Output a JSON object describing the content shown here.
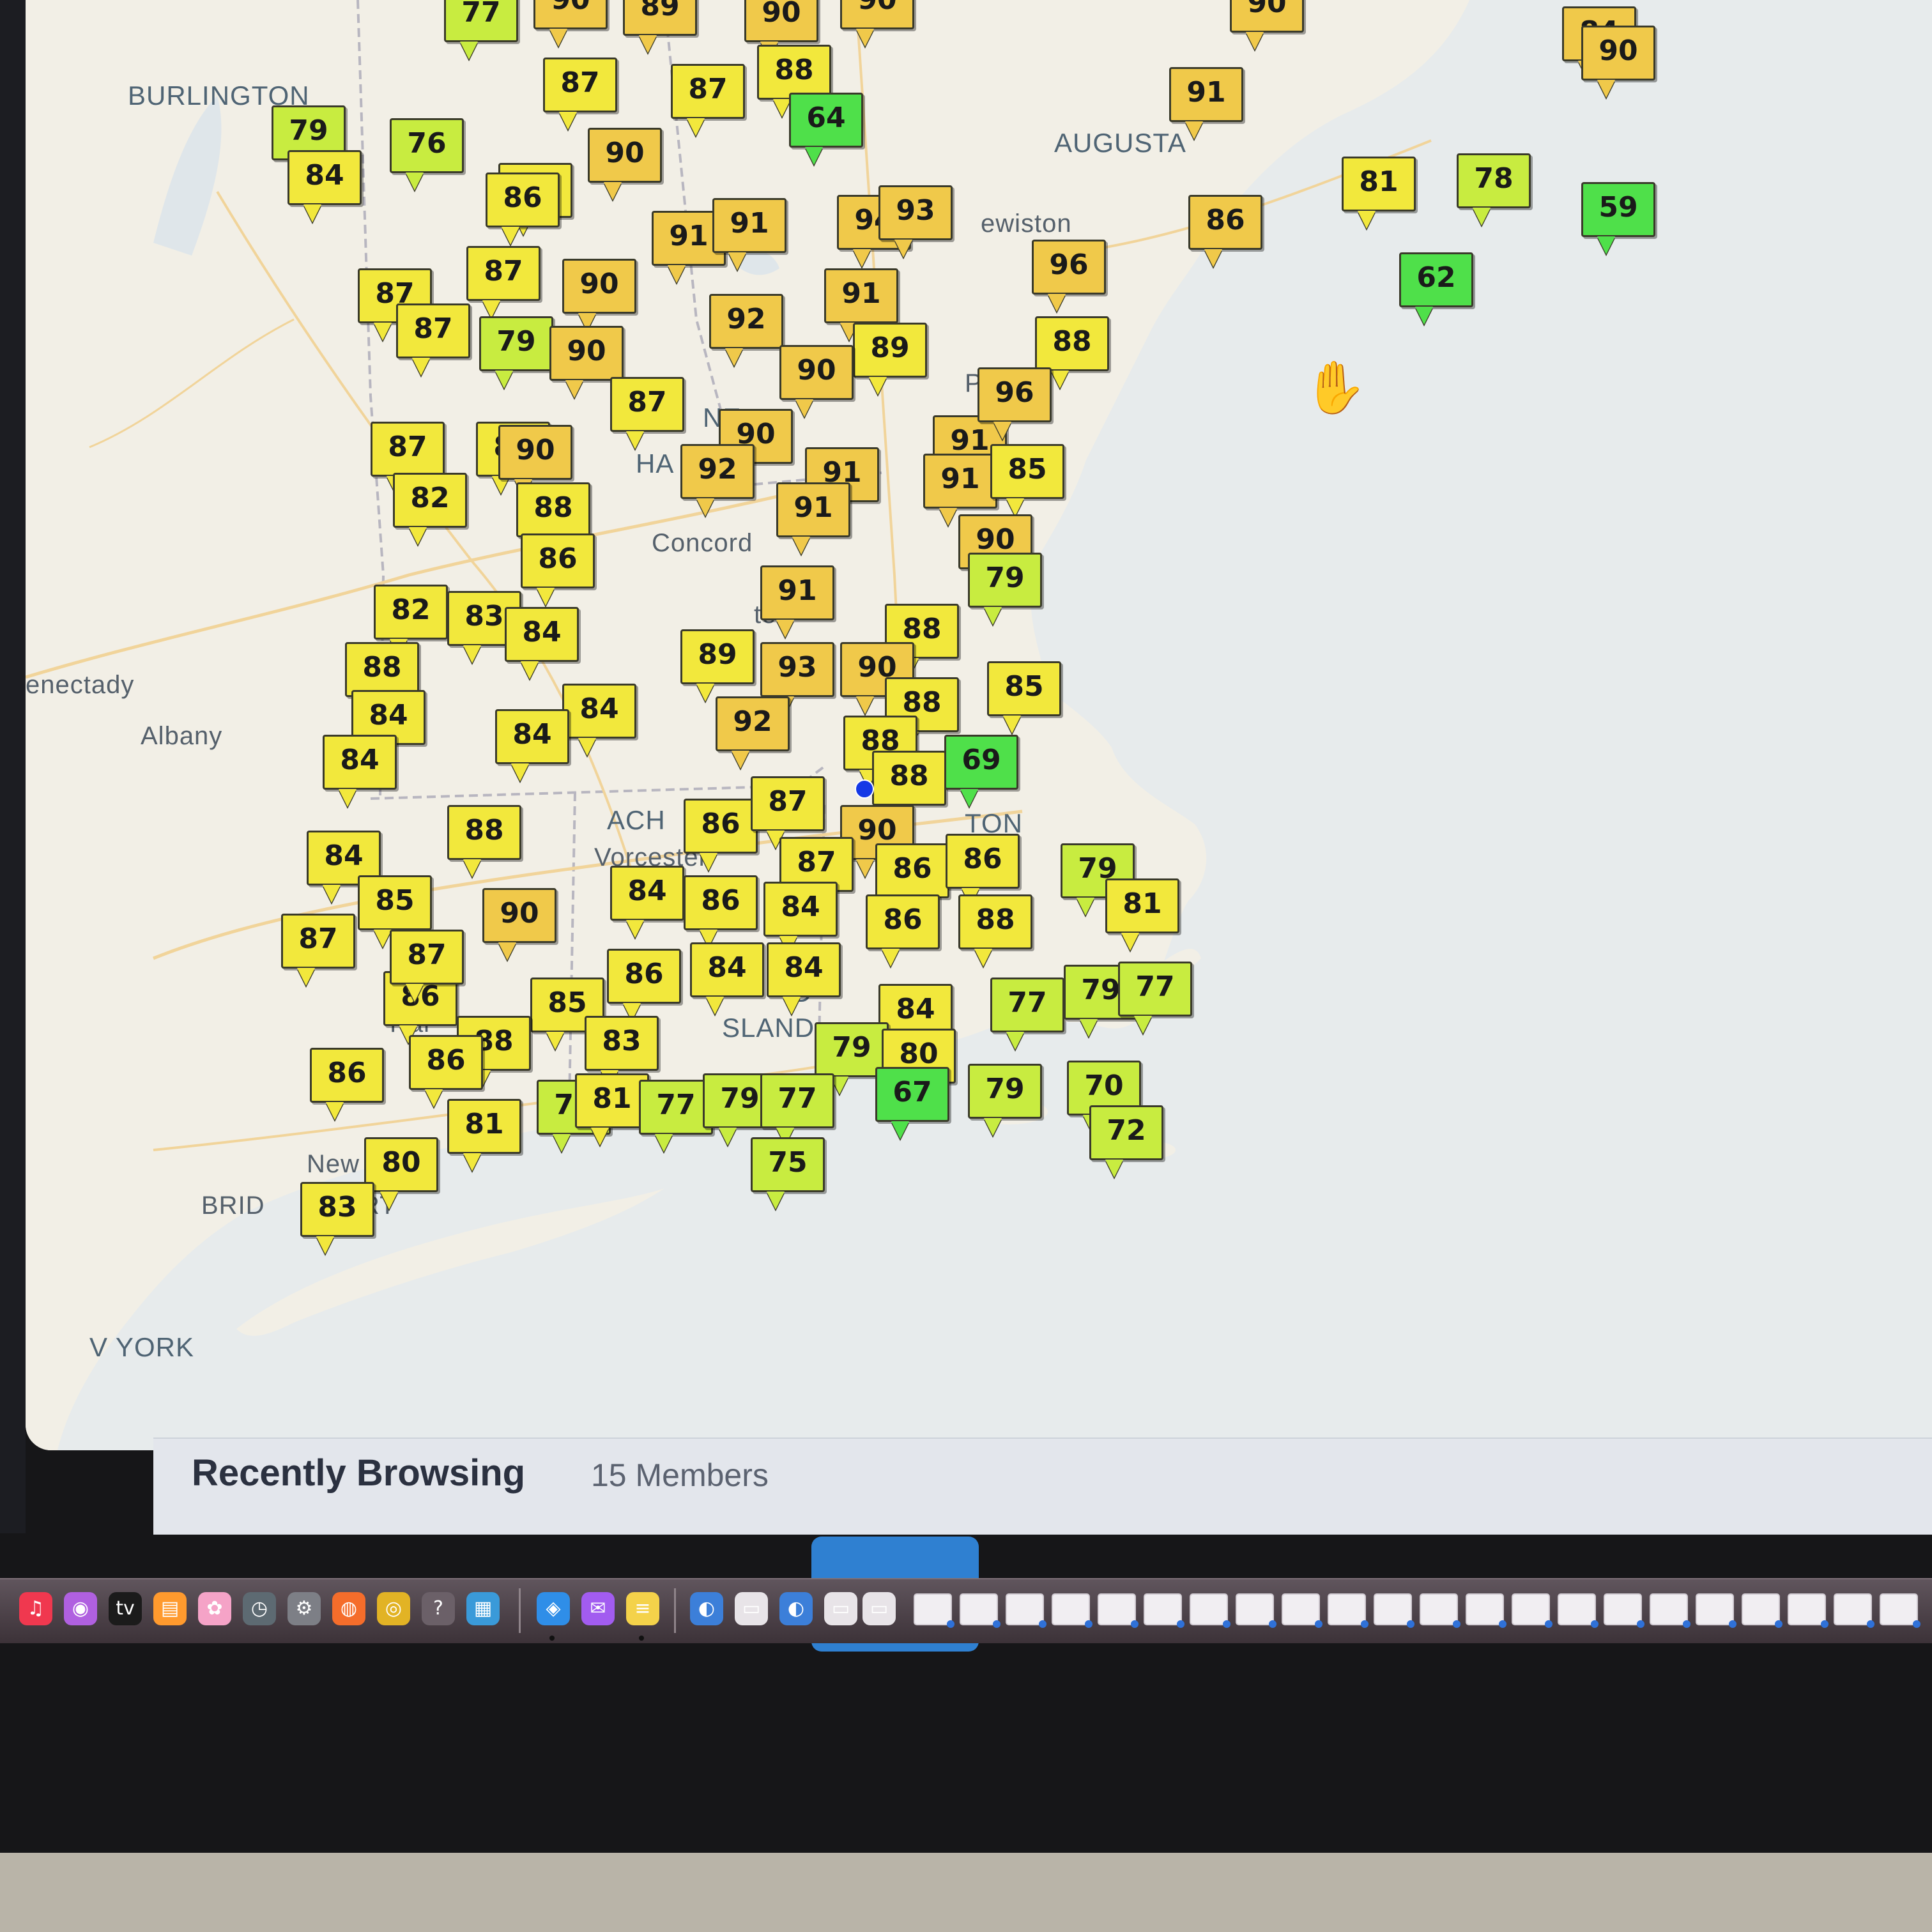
{
  "map": {
    "cities": {
      "burlington": "BURLINGTON",
      "augusta": "AUGUSTA",
      "lewiston": "ewiston",
      "portland": "Port",
      "concord": "Concord",
      "schenectady": "enectady",
      "albany": "Albany",
      "state_ne": "NE",
      "state_ha": "HA",
      "massachusetts": "ACH",
      "worcester": "Vorcester",
      "boston": "TON",
      "rhode_island": "SLAND",
      "rhode_island_prefix": "D",
      "hartford": "Hal",
      "new_haven": "New",
      "bridgeport": "BRID",
      "bridgeport_suffix": "RT",
      "new_york": "V YORK",
      "lowell_fragment": "ter"
    },
    "colors": {
      "ocean": "#e7ebec",
      "land": "#f2efe6",
      "marker_yellow": "#f2e83c",
      "marker_gold": "#f0c94a",
      "marker_lime": "#c8ec40",
      "marker_green": "#4fe04a"
    },
    "markers": [
      {
        "v": "77",
        "c": "lime"
      },
      {
        "v": "90",
        "c": "gold"
      },
      {
        "v": "89",
        "c": "gold"
      },
      {
        "v": "90",
        "c": "gold"
      },
      {
        "v": "90",
        "c": "gold"
      },
      {
        "v": "90",
        "c": "gold"
      },
      {
        "v": "84",
        "c": "gold"
      },
      {
        "v": "90",
        "c": "gold"
      },
      {
        "v": "87",
        "c": "yellow"
      },
      {
        "v": "87",
        "c": "yellow"
      },
      {
        "v": "88",
        "c": "yellow"
      },
      {
        "v": "64",
        "c": "green"
      },
      {
        "v": "91",
        "c": "gold"
      },
      {
        "v": "79",
        "c": "lime"
      },
      {
        "v": "84",
        "c": "yellow"
      },
      {
        "v": "76",
        "c": "lime"
      },
      {
        "v": "86",
        "c": "yellow"
      },
      {
        "v": "90",
        "c": "gold"
      },
      {
        "v": "81",
        "c": "yellow"
      },
      {
        "v": "78",
        "c": "lime"
      },
      {
        "v": "59",
        "c": "green"
      },
      {
        "v": "86",
        "c": "yellow"
      },
      {
        "v": "94",
        "c": "gold"
      },
      {
        "v": "93",
        "c": "gold"
      },
      {
        "v": "91",
        "c": "gold"
      },
      {
        "v": "91",
        "c": "gold"
      },
      {
        "v": "86",
        "c": "gold"
      },
      {
        "v": "96",
        "c": "gold"
      },
      {
        "v": "62",
        "c": "green"
      },
      {
        "v": "87",
        "c": "yellow"
      },
      {
        "v": "87",
        "c": "yellow"
      },
      {
        "v": "90",
        "c": "gold"
      },
      {
        "v": "92",
        "c": "gold"
      },
      {
        "v": "91",
        "c": "gold"
      },
      {
        "v": "87",
        "c": "yellow"
      },
      {
        "v": "79",
        "c": "lime"
      },
      {
        "v": "90",
        "c": "gold"
      },
      {
        "v": "89",
        "c": "yellow"
      },
      {
        "v": "88",
        "c": "yellow"
      },
      {
        "v": "90",
        "c": "gold"
      },
      {
        "v": "87",
        "c": "yellow"
      },
      {
        "v": "91",
        "c": "gold"
      },
      {
        "v": "96",
        "c": "gold"
      },
      {
        "v": "87",
        "c": "yellow"
      },
      {
        "v": "83",
        "c": "yellow"
      },
      {
        "v": "90",
        "c": "gold"
      },
      {
        "v": "90",
        "c": "gold"
      },
      {
        "v": "91",
        "c": "gold"
      },
      {
        "v": "82",
        "c": "yellow"
      },
      {
        "v": "88",
        "c": "yellow"
      },
      {
        "v": "92",
        "c": "gold"
      },
      {
        "v": "91",
        "c": "gold"
      },
      {
        "v": "91",
        "c": "gold"
      },
      {
        "v": "85",
        "c": "yellow"
      },
      {
        "v": "86",
        "c": "yellow"
      },
      {
        "v": "90",
        "c": "gold"
      },
      {
        "v": "79",
        "c": "lime"
      },
      {
        "v": "82",
        "c": "yellow"
      },
      {
        "v": "83",
        "c": "yellow"
      },
      {
        "v": "84",
        "c": "yellow"
      },
      {
        "v": "91",
        "c": "gold"
      },
      {
        "v": "89",
        "c": "yellow"
      },
      {
        "v": "88",
        "c": "yellow"
      },
      {
        "v": "88",
        "c": "yellow"
      },
      {
        "v": "93",
        "c": "gold"
      },
      {
        "v": "90",
        "c": "gold"
      },
      {
        "v": "85",
        "c": "yellow"
      },
      {
        "v": "84",
        "c": "yellow"
      },
      {
        "v": "84",
        "c": "yellow"
      },
      {
        "v": "92",
        "c": "gold"
      },
      {
        "v": "88",
        "c": "yellow"
      },
      {
        "v": "88",
        "c": "yellow"
      },
      {
        "v": "84",
        "c": "yellow"
      },
      {
        "v": "84",
        "c": "yellow"
      },
      {
        "v": "88",
        "c": "yellow"
      },
      {
        "v": "69",
        "c": "green"
      },
      {
        "v": "84",
        "c": "yellow"
      },
      {
        "v": "88",
        "c": "yellow"
      },
      {
        "v": "86",
        "c": "yellow"
      },
      {
        "v": "87",
        "c": "yellow"
      },
      {
        "v": "90",
        "c": "gold"
      },
      {
        "v": "85",
        "c": "yellow"
      },
      {
        "v": "84",
        "c": "yellow"
      },
      {
        "v": "86",
        "c": "yellow"
      },
      {
        "v": "87",
        "c": "yellow"
      },
      {
        "v": "86",
        "c": "yellow"
      },
      {
        "v": "86",
        "c": "yellow"
      },
      {
        "v": "79",
        "c": "lime"
      },
      {
        "v": "81",
        "c": "yellow"
      },
      {
        "v": "87",
        "c": "yellow"
      },
      {
        "v": "90",
        "c": "gold"
      },
      {
        "v": "84",
        "c": "yellow"
      },
      {
        "v": "86",
        "c": "yellow"
      },
      {
        "v": "88",
        "c": "yellow"
      },
      {
        "v": "86",
        "c": "yellow"
      },
      {
        "v": "87",
        "c": "yellow"
      },
      {
        "v": "86",
        "c": "yellow"
      },
      {
        "v": "84",
        "c": "yellow"
      },
      {
        "v": "84",
        "c": "yellow"
      },
      {
        "v": "84",
        "c": "yellow"
      },
      {
        "v": "77",
        "c": "lime"
      },
      {
        "v": "79",
        "c": "lime"
      },
      {
        "v": "77",
        "c": "lime"
      },
      {
        "v": "85",
        "c": "yellow"
      },
      {
        "v": "88",
        "c": "yellow"
      },
      {
        "v": "83",
        "c": "yellow"
      },
      {
        "v": "79",
        "c": "lime"
      },
      {
        "v": "80",
        "c": "yellow"
      },
      {
        "v": "86",
        "c": "yellow"
      },
      {
        "v": "86",
        "c": "yellow"
      },
      {
        "v": "79",
        "c": "lime"
      },
      {
        "v": "81",
        "c": "yellow"
      },
      {
        "v": "77",
        "c": "lime"
      },
      {
        "v": "79",
        "c": "lime"
      },
      {
        "v": "77",
        "c": "lime"
      },
      {
        "v": "67",
        "c": "green"
      },
      {
        "v": "79",
        "c": "lime"
      },
      {
        "v": "70",
        "c": "lime"
      },
      {
        "v": "81",
        "c": "yellow"
      },
      {
        "v": "80",
        "c": "yellow"
      },
      {
        "v": "83",
        "c": "yellow"
      },
      {
        "v": "75",
        "c": "lime"
      },
      {
        "v": "72",
        "c": "lime"
      }
    ]
  },
  "forum": {
    "recent_title": "Recently Browsing",
    "recent_count": "15 Members"
  },
  "dock": {
    "apps": [
      {
        "name": "music-icon",
        "glyph": "♫",
        "color": "#f0384f"
      },
      {
        "name": "podcasts-icon",
        "glyph": "◉",
        "color": "#b060e0"
      },
      {
        "name": "apple-tv-icon",
        "glyph": "tv",
        "color": "#1b1b1b"
      },
      {
        "name": "books-icon",
        "glyph": "▤",
        "color": "#ff9a2e"
      },
      {
        "name": "photos-icon",
        "glyph": "✿",
        "color": "#f5a3c7"
      },
      {
        "name": "time-machine-icon",
        "glyph": "◷",
        "color": "#5d6a72"
      },
      {
        "name": "system-settings-icon",
        "glyph": "⚙",
        "color": "#7d7f86"
      },
      {
        "name": "firefox-icon",
        "glyph": "◍",
        "color": "#f56d2b"
      },
      {
        "name": "chrome-icon",
        "glyph": "◎",
        "color": "#e2b325"
      },
      {
        "name": "help-icon",
        "glyph": "?",
        "color": "#6b6068"
      },
      {
        "name": "preview-icon",
        "glyph": "▦",
        "color": "#3a9ad9"
      },
      {
        "name": "safari-icon",
        "glyph": "◈",
        "color": "#2f8ee8"
      },
      {
        "name": "messenger-icon",
        "glyph": "✉",
        "color": "#a25cf0"
      },
      {
        "name": "notes-icon",
        "glyph": "≡",
        "color": "#f4d24a"
      },
      {
        "name": "globe-icon",
        "glyph": "◐",
        "color": "#3c7fd9"
      },
      {
        "name": "document-icon",
        "glyph": "▭",
        "color": "#e8e4e8"
      },
      {
        "name": "globe-2-icon",
        "glyph": "◐",
        "color": "#3c7fd9"
      },
      {
        "name": "pdf-icon",
        "glyph": "▭",
        "color": "#e8e4e8"
      },
      {
        "name": "text-file-icon",
        "glyph": "▭",
        "color": "#e8e4e8"
      }
    ]
  }
}
